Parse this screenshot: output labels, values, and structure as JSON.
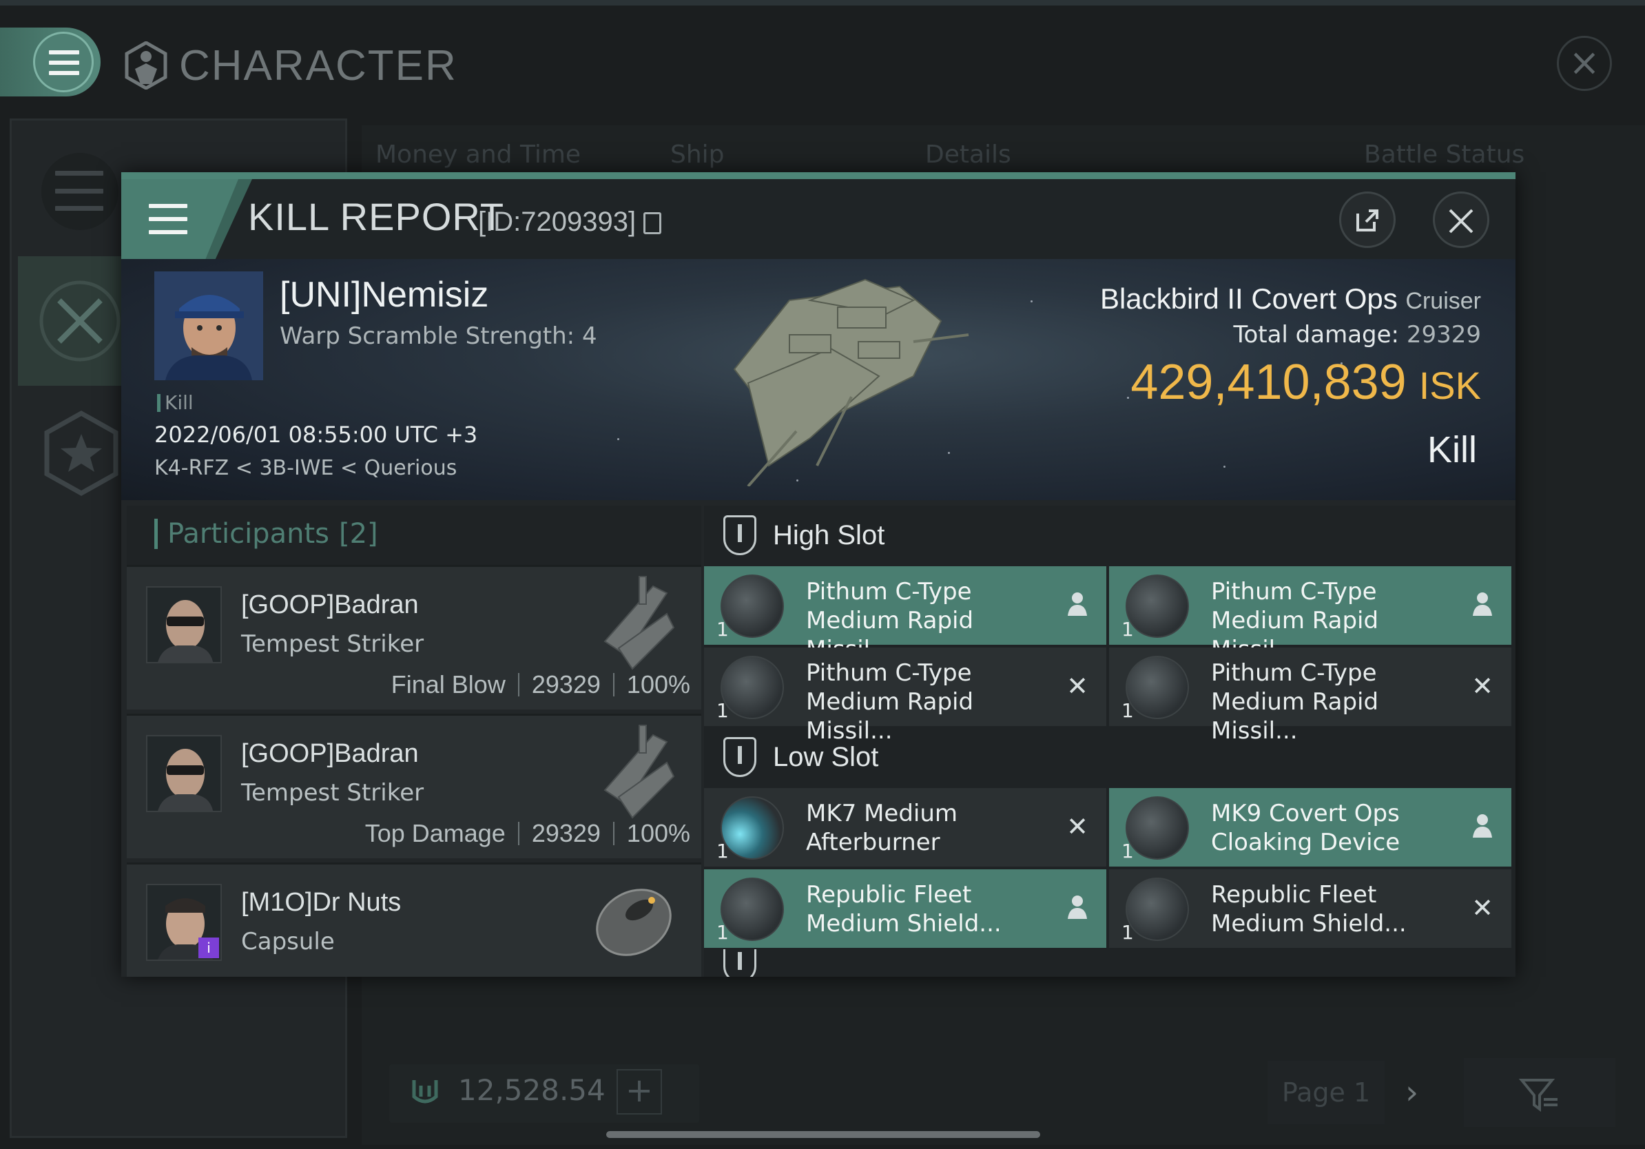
{
  "background_window": {
    "title": "CHARACTER",
    "tabs": [
      "Money and Time",
      "Ship",
      "Details",
      "Battle Status"
    ],
    "wallet_amount": "12,528.54",
    "page_label": "Page 1"
  },
  "kill_report": {
    "title": "KILL REPORT",
    "id_label": "[ID:7209393]",
    "victim": {
      "name": "[UNI]Nemisiz",
      "sub_line": "Warp Scramble Strength: 4",
      "type_tag": "Kill",
      "datetime": "2022/06/01 08:55:00 UTC +3",
      "location": "K4-RFZ < 3B-IWE < Querious"
    },
    "ship": {
      "name": "Blackbird II Covert Ops",
      "class": "Cruiser",
      "total_damage_label": "Total damage:",
      "total_damage": "29329",
      "isk_value": "429,410,839",
      "isk_unit": "ISK",
      "result": "Kill"
    },
    "participants": {
      "label": "Participants",
      "count": "[2]",
      "items": [
        {
          "name": "[GOOP]Badran",
          "ship": "Tempest Striker",
          "role": "Final Blow",
          "damage": "29329",
          "percent": "100%"
        },
        {
          "name": "[GOOP]Badran",
          "ship": "Tempest Striker",
          "role": "Top Damage",
          "damage": "29329",
          "percent": "100%"
        },
        {
          "name": "[M1O]Dr Nuts",
          "ship": "Capsule",
          "alpha_badge": "ⅰ"
        }
      ]
    },
    "fitting": {
      "high_slot_label": "High Slot",
      "low_slot_label": "Low Slot",
      "high": [
        {
          "name_line1": "Pithum C-Type",
          "name_line2": "Medium Rapid Missil...",
          "qty": "1",
          "state": "dropped"
        },
        {
          "name_line1": "Pithum C-Type",
          "name_line2": "Medium Rapid Missil...",
          "qty": "1",
          "state": "dropped"
        },
        {
          "name_line1": "Pithum C-Type",
          "name_line2": "Medium Rapid Missil...",
          "qty": "1",
          "state": "destroyed"
        },
        {
          "name_line1": "Pithum C-Type",
          "name_line2": "Medium Rapid Missil...",
          "qty": "1",
          "state": "destroyed"
        }
      ],
      "low": [
        {
          "name_line1": "MK7 Medium",
          "name_line2": "Afterburner",
          "qty": "1",
          "state": "destroyed"
        },
        {
          "name_line1": "MK9 Covert Ops",
          "name_line2": "Cloaking Device",
          "qty": "1",
          "state": "dropped"
        },
        {
          "name_line1": "Republic Fleet",
          "name_line2": "Medium Shield...",
          "qty": "1",
          "state": "dropped"
        },
        {
          "name_line1": "Republic Fleet",
          "name_line2": "Medium Shield...",
          "qty": "1",
          "state": "destroyed"
        }
      ]
    }
  },
  "colors": {
    "accent": "#4a7e71",
    "isk": "#f0b84a",
    "panel": "#222628"
  },
  "icons": {
    "dropped": "person-icon",
    "destroyed": "cross-icon"
  }
}
